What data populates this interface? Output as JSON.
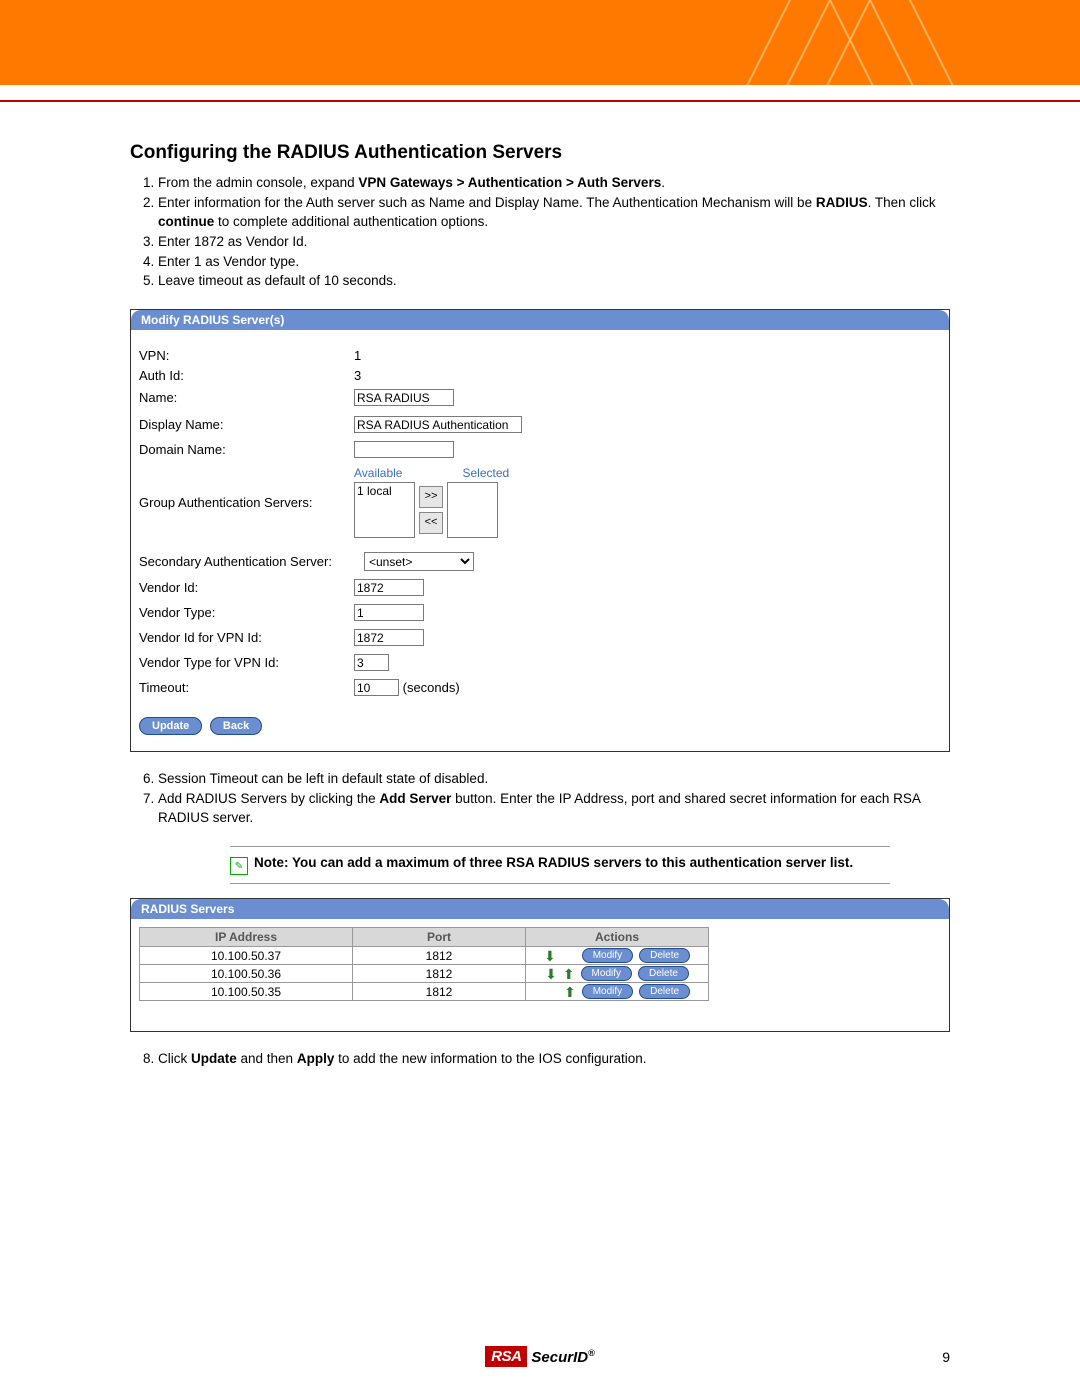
{
  "title": "Configuring the RADIUS Authentication Servers",
  "steps_a": {
    "s1_pre": "From the admin console, expand ",
    "s1_bold": "VPN Gateways > Authentication > Auth Servers",
    "s1_post": ".",
    "s2_pre": "Enter information for the Auth server such as Name and Display Name.  The Authentication Mechanism will be ",
    "s2_b1": "RADIUS",
    "s2_mid": ".  Then click ",
    "s2_b2": "continue",
    "s2_post": " to complete additional authentication options.",
    "s3": "Enter 1872 as Vendor Id.",
    "s4": "Enter 1 as Vendor type.",
    "s5": "Leave timeout as default of 10 seconds."
  },
  "panel1": {
    "title": "Modify RADIUS Server(s)",
    "labels": {
      "vpn": "VPN:",
      "auth_id": "Auth Id:",
      "name": "Name:",
      "display_name": "Display Name:",
      "domain_name": "Domain Name:",
      "group_auth": "Group Authentication Servers:",
      "available": "Available",
      "selected": "Selected",
      "sec_auth": "Secondary Authentication Server:",
      "vendor_id": "Vendor Id:",
      "vendor_type": "Vendor Type:",
      "vendor_id_vpn": "Vendor Id for VPN Id:",
      "vendor_type_vpn": "Vendor Type for VPN Id:",
      "timeout": "Timeout:",
      "seconds": "(seconds)"
    },
    "values": {
      "vpn": "1",
      "auth_id": "3",
      "name": "RSA RADIUS",
      "display_name": "RSA RADIUS Authentication",
      "domain_name": "",
      "available_item": "1  local",
      "sec_auth": "<unset>",
      "vendor_id": "1872",
      "vendor_type": "1",
      "vendor_id_vpn": "1872",
      "vendor_type_vpn": "3",
      "timeout": "10",
      "move_right": ">>",
      "move_left": "<<"
    },
    "buttons": {
      "update": "Update",
      "back": "Back"
    }
  },
  "steps_b": {
    "s6": "Session Timeout can be left in default state of disabled.",
    "s7_pre": "Add RADIUS Servers by clicking the ",
    "s7_bold": "Add Server",
    "s7_post": " button.  Enter the IP Address, port and shared secret information for each RSA RADIUS server."
  },
  "note": {
    "pre": "Note: You can add a maximum of three RSA RADIUS servers to this authentication server list."
  },
  "panel2": {
    "title": "RADIUS Servers",
    "headers": {
      "ip": "IP Address",
      "port": "Port",
      "actions": "Actions"
    },
    "rows": [
      {
        "ip": "10.100.50.37",
        "port": "1812",
        "down": true,
        "up": false
      },
      {
        "ip": "10.100.50.36",
        "port": "1812",
        "down": true,
        "up": true
      },
      {
        "ip": "10.100.50.35",
        "port": "1812",
        "down": false,
        "up": true
      }
    ],
    "buttons": {
      "modify": "Modify",
      "delete": "Delete"
    }
  },
  "steps_c": {
    "s8_pre": "Click ",
    "s8_b1": "Update",
    "s8_mid": " and then ",
    "s8_b2": "Apply",
    "s8_post": " to add the new information to the IOS configuration."
  },
  "footer": {
    "rsa": "RSA",
    "securid": "SecurID",
    "reg": "®",
    "page": "9"
  }
}
